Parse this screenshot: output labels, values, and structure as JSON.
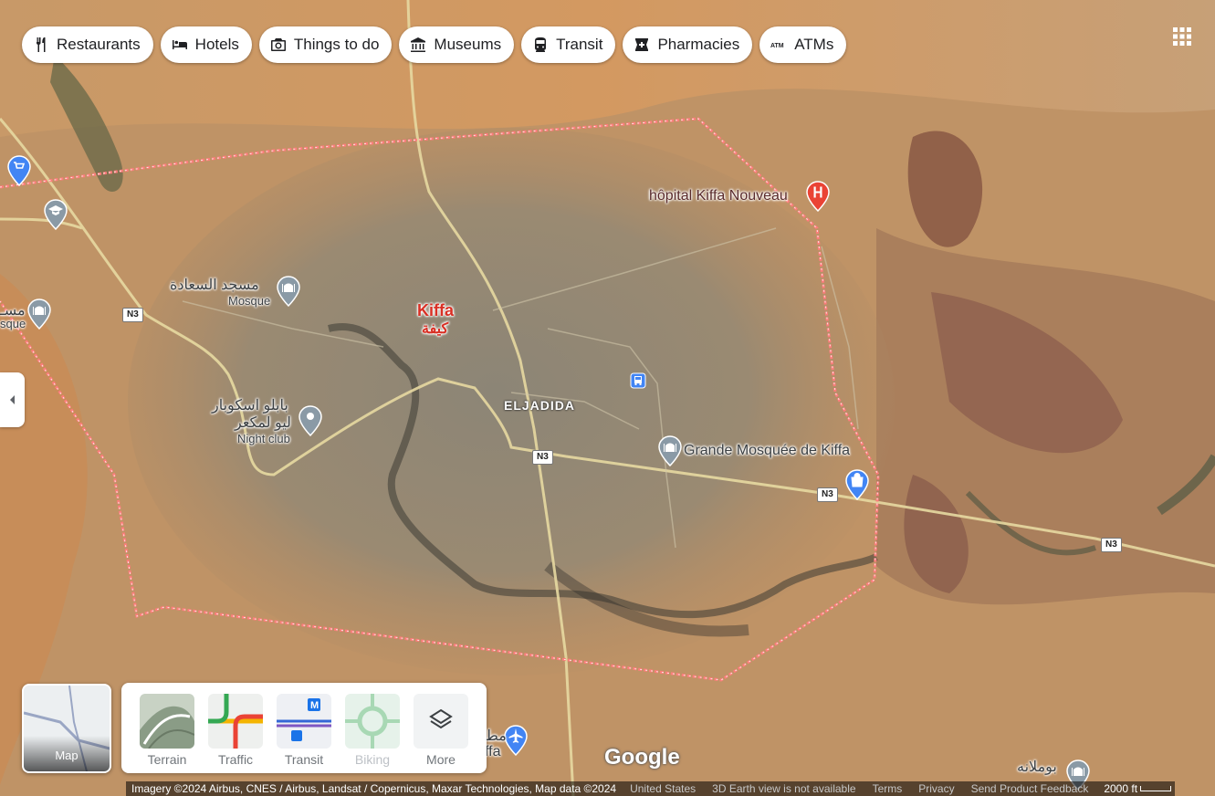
{
  "chips": [
    {
      "label": "Restaurants",
      "icon": "fork-knife-icon"
    },
    {
      "label": "Hotels",
      "icon": "bed-icon"
    },
    {
      "label": "Things to do",
      "icon": "camera-icon"
    },
    {
      "label": "Museums",
      "icon": "museum-icon"
    },
    {
      "label": "Transit",
      "icon": "train-icon"
    },
    {
      "label": "Pharmacies",
      "icon": "pharmacy-icon"
    },
    {
      "label": "ATMs",
      "icon": "atm-icon"
    }
  ],
  "map": {
    "city_name": "Kiffa",
    "city_name_ar": "كيفة",
    "district": "ELJADIDA",
    "places": {
      "hospital": "hôpital Kiffa Nouveau",
      "grand_mosque": "Grande Mosquée de Kiffa",
      "mosque_ar": "مسجد السعادة",
      "mosque_type": "Mosque",
      "nightclub_ar_1": "بابلو اسكوبار",
      "nightclub_ar_2": "ليو لمكعر",
      "nightclub_type": "Night club",
      "left_mosque_partial": "مسـ",
      "left_mosque_type_partial": "sque",
      "bottom_right_ar": "بوملانه",
      "bottom_partial": "ffa",
      "bottom_partial_ar": "مط"
    },
    "road_shields": [
      "N3",
      "N3",
      "N3",
      "N3"
    ],
    "colors": {
      "boundary": "#ff6b6b",
      "pin_red": "#ea4335",
      "pin_gray": "#8a9aa6",
      "pin_blue": "#4285f4",
      "city_label": "#d93025"
    }
  },
  "layers": {
    "current_label": "Map",
    "options": [
      {
        "label": "Terrain",
        "enabled": true
      },
      {
        "label": "Traffic",
        "enabled": true
      },
      {
        "label": "Transit",
        "enabled": true
      },
      {
        "label": "Biking",
        "enabled": false
      },
      {
        "label": "More",
        "enabled": true
      }
    ]
  },
  "branding": "Google",
  "footer": {
    "attribution": "Imagery ©2024 Airbus, CNES / Airbus, Landsat / Copernicus, Maxar Technologies, Map data ©2024",
    "links": [
      "United States",
      "3D Earth view is not available",
      "Terms",
      "Privacy",
      "Send Product Feedback"
    ],
    "scale": "2000 ft"
  }
}
